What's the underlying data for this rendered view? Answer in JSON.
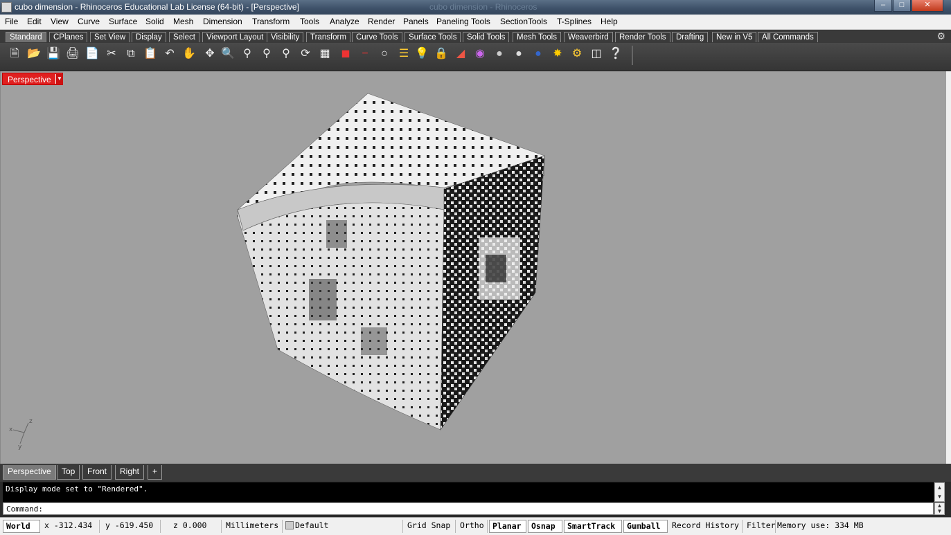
{
  "window": {
    "title": "cubo dimension - Rhinoceros Educational Lab License (64-bit) - [Perspective]",
    "ghost_title": "cubo dimension - Rhinoceros"
  },
  "menu": [
    "File",
    "Edit",
    "View",
    "Curve",
    "Surface",
    "Solid",
    "Mesh",
    "Dimension",
    "Transform",
    "Tools",
    "Analyze",
    "Render",
    "Panels",
    "Paneling Tools",
    "SectionTools",
    "T-Splines",
    "Help"
  ],
  "toolbar_tabs": [
    "Standard",
    "CPlanes",
    "Set View",
    "Display",
    "Select",
    "Viewport Layout",
    "Visibility",
    "Transform",
    "Curve Tools",
    "Surface Tools",
    "Solid Tools",
    "Mesh Tools",
    "Weaverbird",
    "Render Tools",
    "Drafting",
    "New in V5",
    "All Commands"
  ],
  "toolbar_icons": [
    "new-icon",
    "open-icon",
    "save-icon",
    "print-icon",
    "import-icon",
    "cut-icon",
    "copy-icon",
    "paste-icon",
    "undo-icon",
    "pan-icon",
    "move-icon",
    "zoom-icon",
    "zoom-window-icon",
    "zoom-extents-icon",
    "zoom-selected-icon",
    "rotate-view-icon",
    "viewports-icon",
    "car-icon",
    "cplane-icon",
    "circle-icon",
    "layers-icon",
    "light-icon",
    "lock-icon",
    "material-icon",
    "color-wheel-icon",
    "sphere-icon",
    "sphere-shaded-icon",
    "sphere-blue-icon",
    "render-icon",
    "options-icon",
    "grid-icon",
    "help-icon"
  ],
  "viewport": {
    "label": "Perspective",
    "axes": {
      "x": "x",
      "y": "y",
      "z": "z"
    }
  },
  "view_tabs": [
    "Perspective",
    "Top",
    "Front",
    "Right",
    "+"
  ],
  "command": {
    "history": "Display mode set to \"Rendered\".",
    "prompt": "Command:"
  },
  "status": {
    "cplane": "World",
    "x": "x -312.434",
    "y": "y -619.450",
    "z": "z 0.000",
    "units": "Millimeters",
    "layer": "Default",
    "toggles": [
      "Grid Snap",
      "Ortho",
      "Planar",
      "Osnap",
      "SmartTrack",
      "Gumball",
      "Record History",
      "Filter"
    ],
    "memory": "Memory use: 334 MB"
  },
  "colors": {
    "viewport_bg": "#a0a0a0",
    "active_view": "#e02020",
    "cube_surface": "#f2f2f2"
  }
}
